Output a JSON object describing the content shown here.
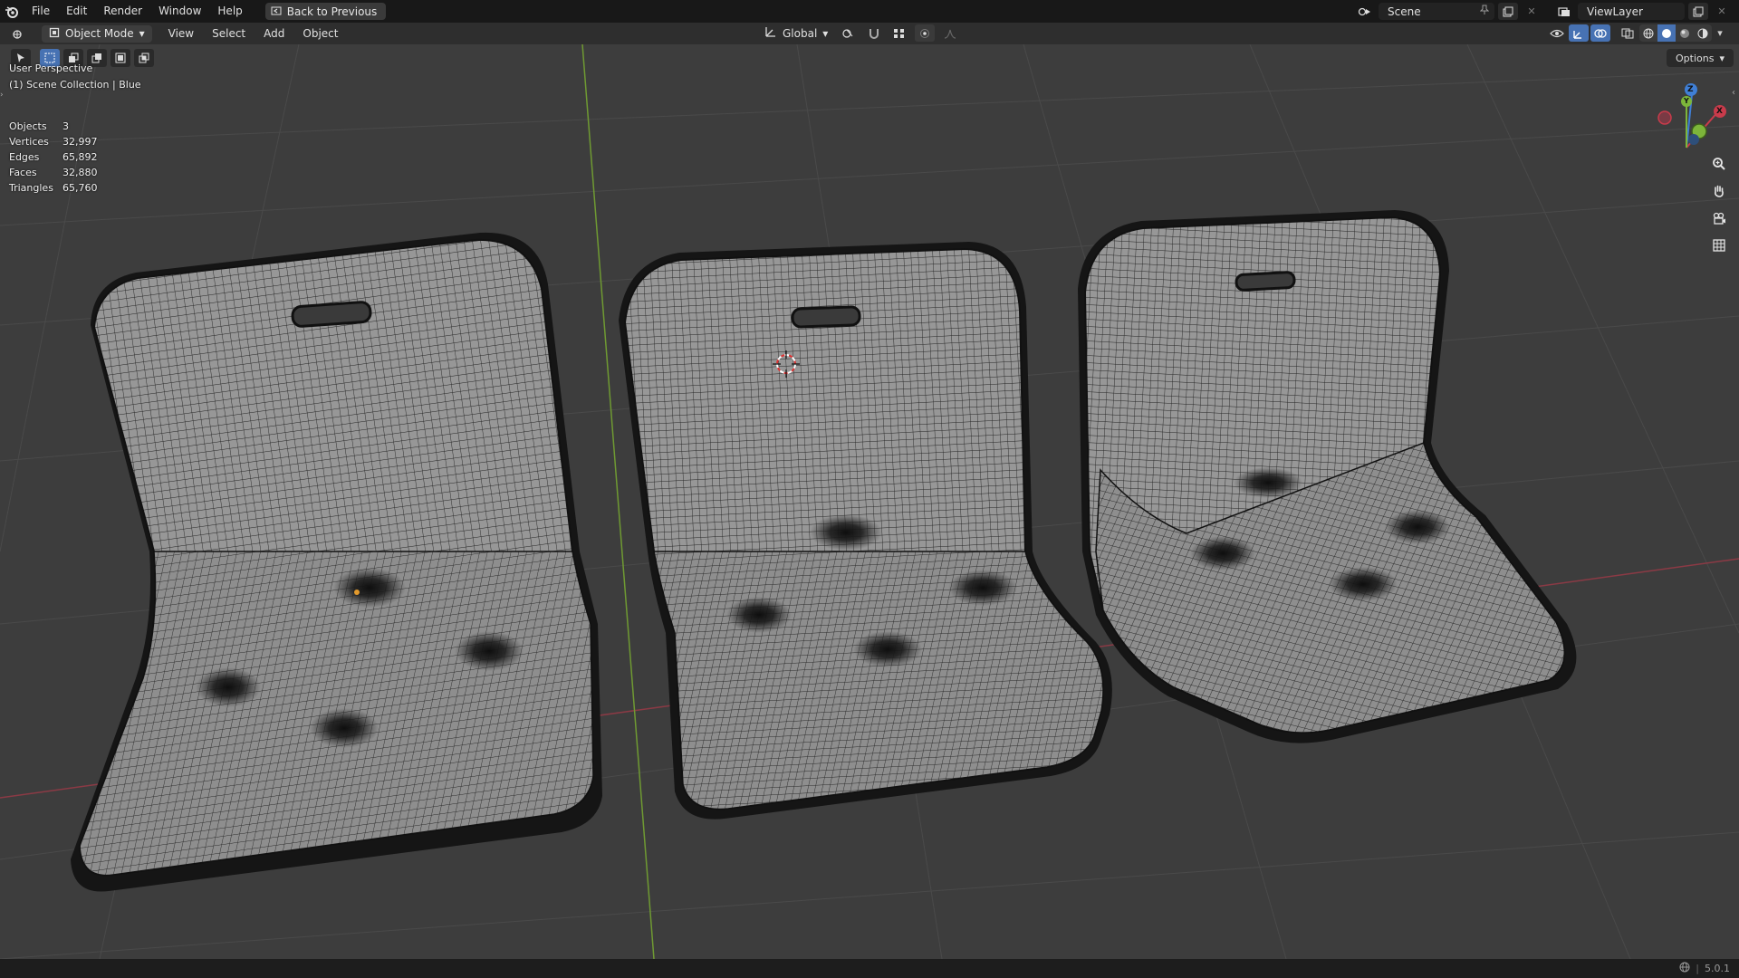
{
  "menubar": {
    "items": [
      "File",
      "Edit",
      "Render",
      "Window",
      "Help"
    ],
    "back_button": "Back to Previous",
    "scene_name": "Scene",
    "view_layer": "ViewLayer"
  },
  "viewport_header": {
    "mode": "Object Mode",
    "menus": [
      "View",
      "Select",
      "Add",
      "Object"
    ],
    "transform_orientation": "Global",
    "options_label": "Options",
    "accent_color": "#4772b3"
  },
  "viewport": {
    "view_name": "User Perspective",
    "collection_info": "(1) Scene Collection | Blue",
    "stats": [
      {
        "label": "Objects",
        "value": "3"
      },
      {
        "label": "Vertices",
        "value": "32,997"
      },
      {
        "label": "Edges",
        "value": "65,892"
      },
      {
        "label": "Faces",
        "value": "32,880"
      },
      {
        "label": "Triangles",
        "value": "65,760"
      }
    ],
    "gizmo_axes": {
      "x": "X",
      "y": "Y",
      "z": "Z"
    },
    "axis_colors": {
      "x": "#c93b4b",
      "y": "#7db53a",
      "z": "#3f7fd6"
    },
    "icons": [
      "zoom-icon",
      "hand-pan-icon",
      "camera-icon",
      "grid-icon"
    ]
  },
  "statusbar": {
    "version": "5.0.1"
  }
}
